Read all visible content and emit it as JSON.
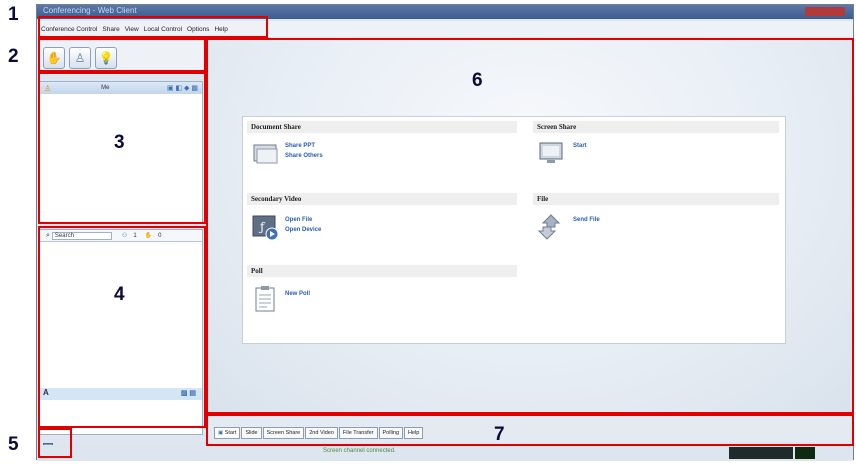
{
  "window": {
    "title": "Conferencing - Web Client"
  },
  "menu": [
    "Conference Control",
    "Share",
    "View",
    "Local Control",
    "Options",
    "Help"
  ],
  "toolbar": {
    "buttons": [
      {
        "icon": "hand-raise-icon"
      },
      {
        "icon": "presenter-icon"
      },
      {
        "icon": "lightbulb-icon"
      }
    ]
  },
  "participants": {
    "col_name": "Me"
  },
  "search": {
    "placeholder": "Search",
    "count1": "1",
    "count2": "0"
  },
  "chat": {
    "label": "A"
  },
  "main": {
    "sections": [
      {
        "title": "Document Share",
        "icon": "folder-icon",
        "links": [
          "Share PPT",
          "Share Others"
        ]
      },
      {
        "title": "Screen Share",
        "icon": "monitor-icon",
        "links": [
          "Start"
        ]
      },
      {
        "title": "Secondary Video",
        "icon": "video-icon",
        "links": [
          "Open File",
          "Open Device"
        ]
      },
      {
        "title": "File",
        "icon": "file-transfer-icon",
        "links": [
          "Send File"
        ]
      },
      {
        "title": "Poll",
        "icon": "clipboard-icon",
        "links": [
          "New Poll"
        ]
      }
    ]
  },
  "tabs": [
    "Start",
    "Slide",
    "Screen Share",
    "2nd Video",
    "File Transfer",
    "Polling",
    "Help"
  ],
  "status": {
    "message": "Screen channel connected."
  },
  "annotations": [
    "1",
    "2",
    "3",
    "4",
    "5",
    "6",
    "7"
  ]
}
